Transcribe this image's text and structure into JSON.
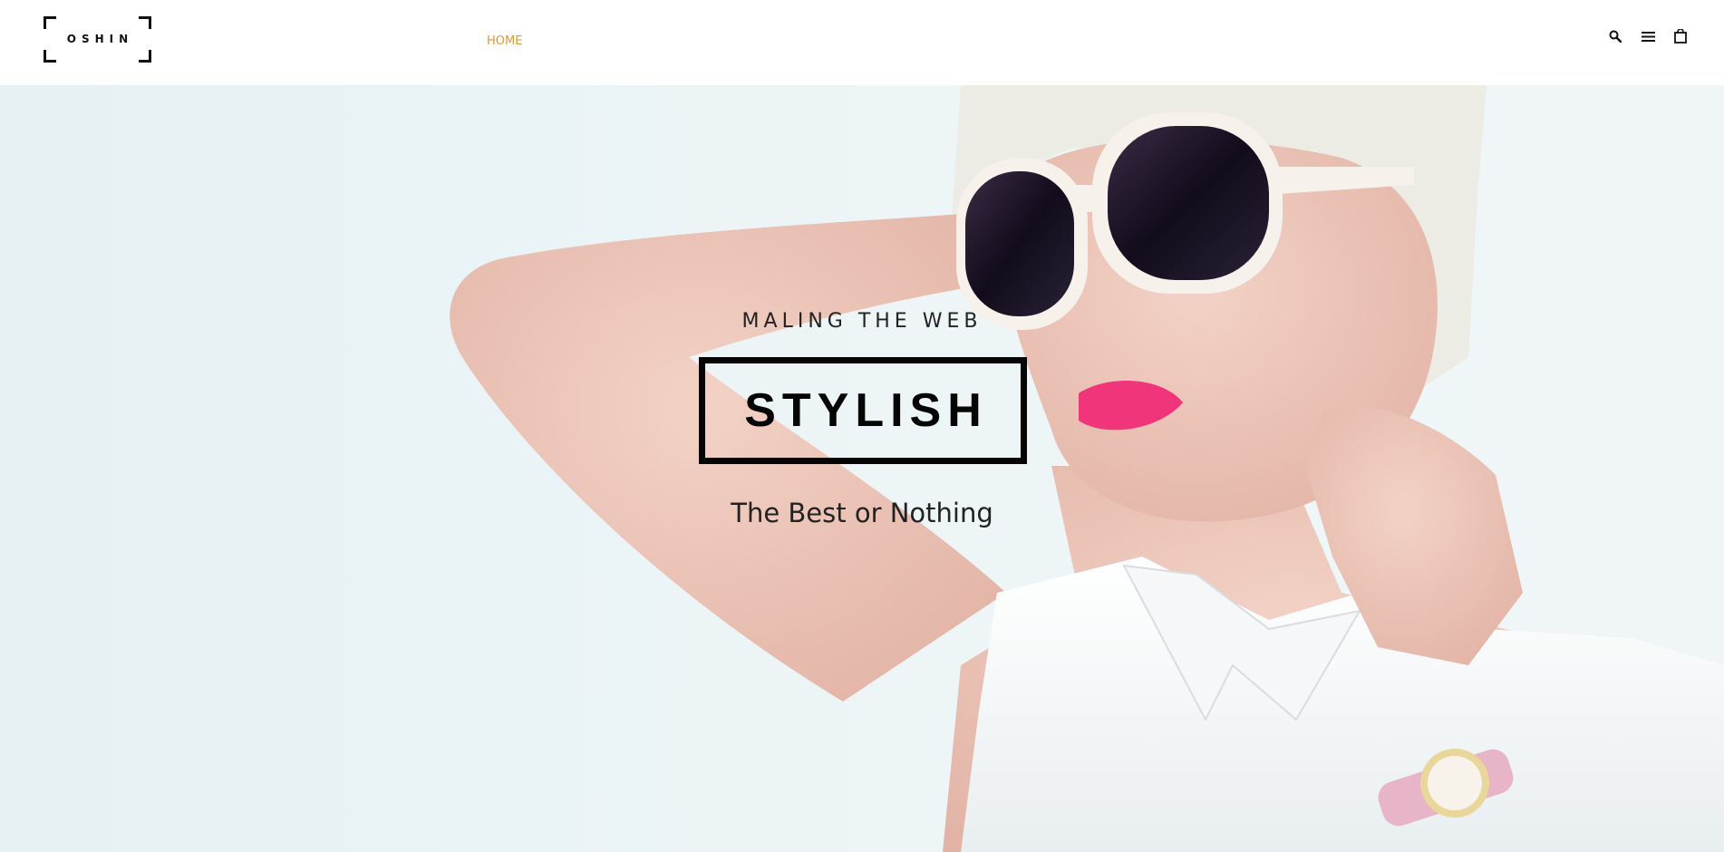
{
  "brand": {
    "name": "OSHIN"
  },
  "nav": {
    "items": [
      {
        "label": "HOME",
        "active": true
      }
    ],
    "active_color": "#d89a3c"
  },
  "tools": {
    "search_icon": "search-icon",
    "menu_icon": "hamburger-menu-icon",
    "cart_icon": "shopping-bag-icon"
  },
  "hero": {
    "kicker": "MALING THE WEB",
    "headline": "STYLISH",
    "tagline": "The Best or Nothing",
    "image": "woman-in-white-sunglasses-photo"
  }
}
